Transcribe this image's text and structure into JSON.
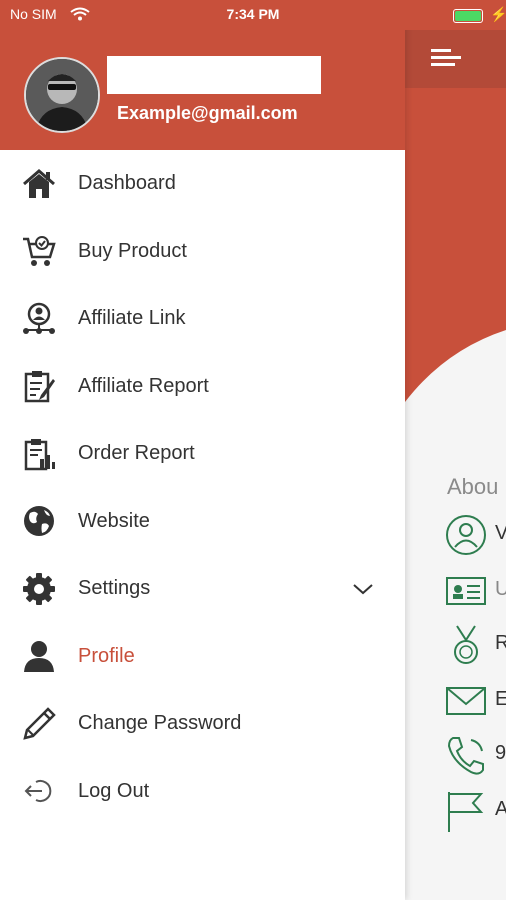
{
  "status_bar": {
    "carrier": "No SIM",
    "time": "7:34 PM"
  },
  "header": {
    "email": "Example@gmail.com",
    "name": ""
  },
  "menu": [
    {
      "label": "Dashboard",
      "icon": "home-icon"
    },
    {
      "label": "Buy Product",
      "icon": "cart-icon"
    },
    {
      "label": "Affiliate Link",
      "icon": "affiliate-network-icon"
    },
    {
      "label": "Affiliate Report",
      "icon": "report-clipboard-icon"
    },
    {
      "label": "Order Report",
      "icon": "order-report-icon"
    },
    {
      "label": "Website",
      "icon": "globe-icon"
    },
    {
      "label": "Settings",
      "icon": "gear-icon",
      "has_submenu": true
    },
    {
      "label": "Profile",
      "icon": "user-icon",
      "active": true
    },
    {
      "label": "Change Password",
      "icon": "pencil-icon"
    },
    {
      "label": "Log Out",
      "icon": "logout-icon"
    }
  ],
  "background": {
    "about_label": "Abou",
    "rows": [
      {
        "text": "V",
        "icon": "user-circle-icon"
      },
      {
        "text": "U",
        "icon": "id-card-icon"
      },
      {
        "text": "R",
        "icon": "medal-icon"
      },
      {
        "text": "E",
        "icon": "envelope-icon"
      },
      {
        "text": "9",
        "icon": "phone-icon"
      },
      {
        "text": "A",
        "icon": "flag-icon"
      }
    ]
  },
  "colors": {
    "brand": "#c8503b",
    "brand_dark": "#b34a38",
    "icon_green": "#2e7d4f",
    "text": "#333333"
  }
}
